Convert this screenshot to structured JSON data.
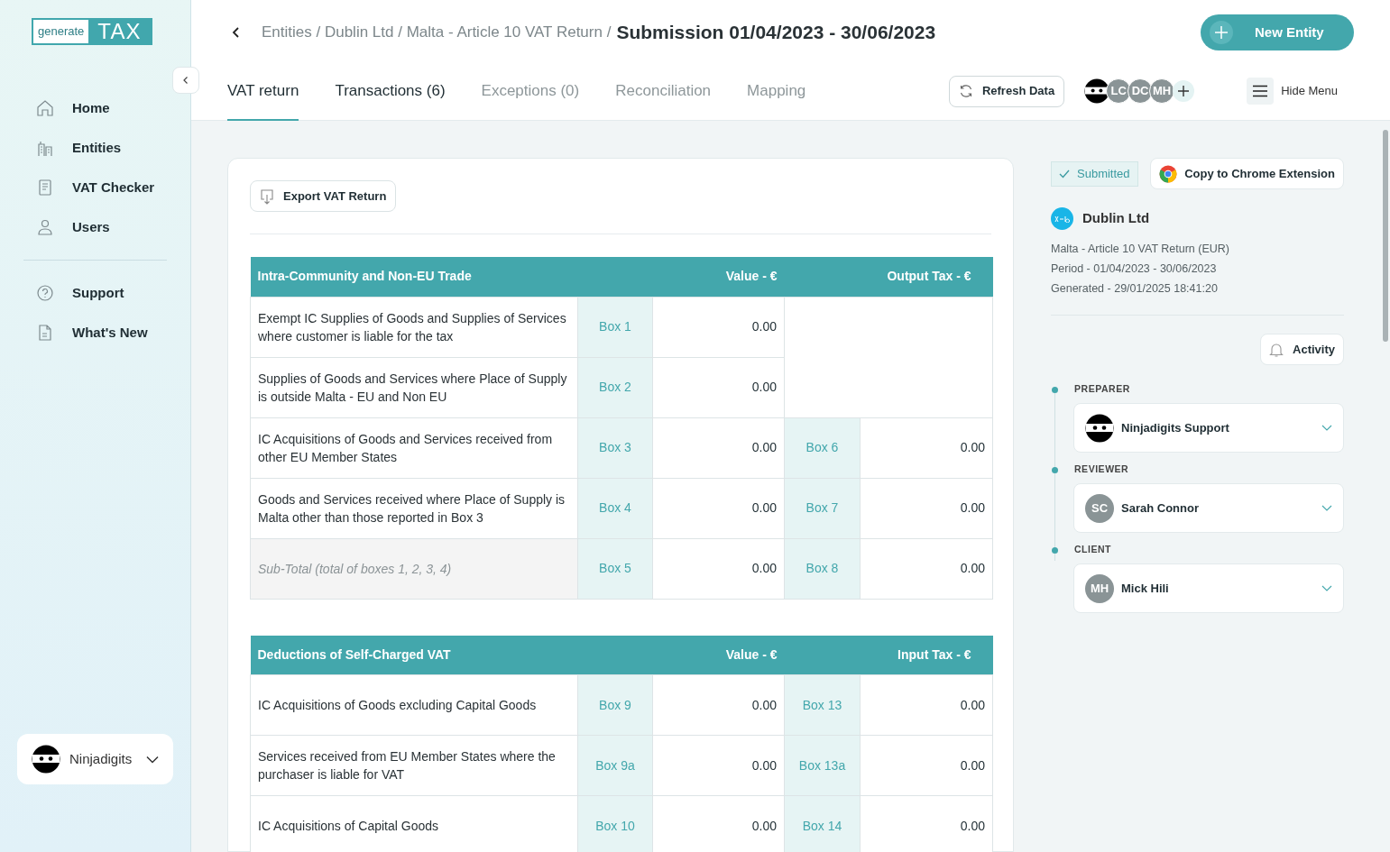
{
  "logo": {
    "left": "generate",
    "right": "TAX"
  },
  "sidebar": {
    "items": [
      {
        "label": "Home"
      },
      {
        "label": "Entities"
      },
      {
        "label": "VAT Checker"
      },
      {
        "label": "Users"
      }
    ],
    "secondary_items": [
      {
        "label": "Support"
      },
      {
        "label": "What's New"
      }
    ],
    "account": {
      "name": "Ninjadigits"
    }
  },
  "breadcrumb": {
    "trail": "Entities / Dublin Ltd / Malta - Article 10 VAT Return /",
    "current": "Submission 01/04/2023 - 30/06/2023"
  },
  "new_entity_button": "New Entity",
  "tabs": [
    {
      "label": "VAT return",
      "selected": true,
      "disabled": false
    },
    {
      "label": "Transactions (6)",
      "selected": false,
      "disabled": false
    },
    {
      "label": "Exceptions (0)",
      "selected": false,
      "disabled": true
    },
    {
      "label": "Reconciliation",
      "selected": false,
      "disabled": true
    },
    {
      "label": "Mapping",
      "selected": false,
      "disabled": true
    }
  ],
  "refresh_button": "Refresh Data",
  "collaborators": [
    {
      "kind": "ninja"
    },
    {
      "kind": "initials",
      "initials": "LC"
    },
    {
      "kind": "initials",
      "initials": "DC"
    },
    {
      "kind": "initials",
      "initials": "MH"
    }
  ],
  "hide_menu": "Hide Menu",
  "export_button": "Export VAT Return",
  "sections": [
    {
      "title": "Intra-Community and Non-EU Trade",
      "value_header": "Value - €",
      "tax_header": "Output Tax - €",
      "rows": [
        {
          "kind": "line",
          "label": "Exempt IC Supplies of Goods and Supplies of Services where customer is liable for the tax",
          "box": "Box 1",
          "value": "0.00"
        },
        {
          "kind": "line",
          "label": "Supplies of Goods and Services where Place of Supply is outside Malta - EU and Non EU",
          "box": "Box 2",
          "value": "0.00"
        },
        {
          "kind": "line",
          "label": "IC Acquisitions of Goods and Services received from other EU Member States",
          "box": "Box 3",
          "value": "0.00",
          "tax_box": "Box 6",
          "tax": "0.00"
        },
        {
          "kind": "line",
          "label": "Goods and Services received where Place of Supply is Malta other than those reported in Box 3",
          "box": "Box 4",
          "value": "0.00",
          "tax_box": "Box 7",
          "tax": "0.00"
        },
        {
          "kind": "subtotal",
          "label": "Sub-Total (total of boxes 1, 2, 3, 4)",
          "box": "Box 5",
          "value": "0.00",
          "tax_box": "Box 8",
          "tax": "0.00"
        }
      ]
    },
    {
      "title": "Deductions of Self-Charged VAT",
      "value_header": "Value - €",
      "tax_header": "Input Tax - €",
      "rows": [
        {
          "kind": "line",
          "label": "IC Acquisitions of Goods excluding Capital Goods",
          "box": "Box 9",
          "value": "0.00",
          "tax_box": "Box 13",
          "tax": "0.00"
        },
        {
          "kind": "line",
          "label": "Services received from EU Member States where the purchaser is liable for VAT",
          "box": "Box 9a",
          "value": "0.00",
          "tax_box": "Box 13a",
          "tax": "0.00"
        },
        {
          "kind": "line",
          "label": "IC Acquisitions of Capital Goods",
          "box": "Box 10",
          "value": "0.00",
          "tax_box": "Box 14",
          "tax": "0.00"
        }
      ]
    }
  ],
  "status": {
    "label": "Submitted"
  },
  "chrome_button": "Copy to Chrome Extension",
  "entity": {
    "name": "Dublin Ltd",
    "details": [
      "Malta - Article 10 VAT Return (EUR)",
      "Period - 01/04/2023 - 30/06/2023",
      "Generated - 29/01/2025 18:41:20"
    ]
  },
  "activity_button": "Activity",
  "workflow": [
    {
      "role": "PREPARER",
      "person": "Ninjadigits Support",
      "avatar": {
        "kind": "ninja"
      }
    },
    {
      "role": "REVIEWER",
      "person": "Sarah Connor",
      "avatar": {
        "kind": "initials",
        "initials": "SC"
      }
    },
    {
      "role": "CLIENT",
      "person": "Mick Hili",
      "avatar": {
        "kind": "initials",
        "initials": "MH"
      }
    }
  ]
}
